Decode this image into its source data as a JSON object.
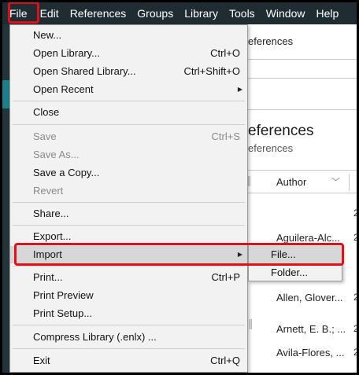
{
  "menubar": {
    "items": [
      "File",
      "Edit",
      "References",
      "Groups",
      "Library",
      "Tools",
      "Window",
      "Help"
    ]
  },
  "file_menu": {
    "new": "New...",
    "open_library": "Open Library...",
    "open_library_sc": "Ctrl+O",
    "open_shared": "Open Shared Library...",
    "open_shared_sc": "Ctrl+Shift+O",
    "open_recent": "Open Recent",
    "close": "Close",
    "save": "Save",
    "save_sc": "Ctrl+S",
    "save_as": "Save As...",
    "save_copy": "Save a Copy...",
    "revert": "Revert",
    "share": "Share...",
    "export": "Export...",
    "import": "Import",
    "print": "Print...",
    "print_sc": "Ctrl+P",
    "print_preview": "Print Preview",
    "print_setup": "Print Setup...",
    "compress": "Compress Library (.enlx) ...",
    "exit": "Exit",
    "exit_sc": "Ctrl+Q"
  },
  "import_submenu": {
    "file": "File...",
    "folder": "Folder..."
  },
  "background": {
    "tab_text": "eferences",
    "title": "eferences",
    "subtitle": "eferences",
    "column_author": "Author",
    "rows": [
      "Aguilera-Alc...",
      "Allen, Glover...",
      "Arnett, E. B.; ...",
      "Avila-Flores, ..."
    ]
  },
  "colors": {
    "menubar_bg": "#1f2d33",
    "highlight_red": "#e0101a",
    "menu_bg": "#f2f2f2",
    "active_bg": "#d7d7d7"
  }
}
